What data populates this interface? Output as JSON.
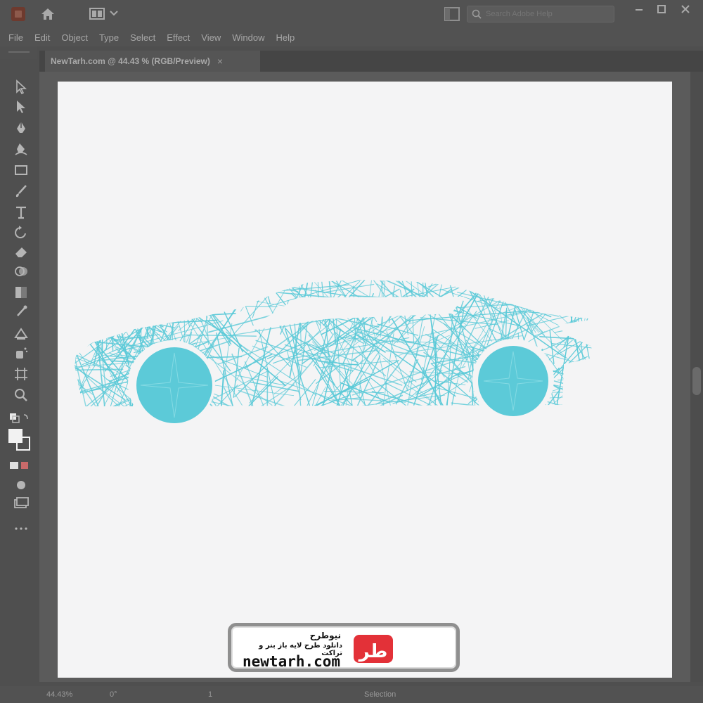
{
  "app": {
    "workspace_icon": "workspace-switcher-icon",
    "search_placeholder": "Search Adobe Help"
  },
  "menu": [
    "File",
    "Edit",
    "Object",
    "Type",
    "Select",
    "Effect",
    "View",
    "Window",
    "Help"
  ],
  "tab": {
    "title": "NewTarh.com @ 44.43 % (RGB/Preview)",
    "close": "×"
  },
  "tools": [
    "selection-tool-icon",
    "direct-selection-tool-icon",
    "pen-tool-icon",
    "curvature-tool-icon",
    "rectangle-tool-icon",
    "paintbrush-tool-icon",
    "type-tool-icon",
    "rotate-tool-icon",
    "eraser-tool-icon",
    "shape-builder-tool-icon",
    "gradient-tool-icon",
    "eyedropper-tool-icon",
    "blend-tool-icon",
    "symbol-sprayer-tool-icon",
    "artboard-tool-icon",
    "zoom-tool-icon",
    "default-colors-icon",
    "fill-stroke-swatch",
    "draw-mode-icon",
    "screen-mode-icon",
    "edit-toolbar-icon"
  ],
  "status": {
    "zoom": "44.43%",
    "rotation": "0°",
    "artboard": "1",
    "tool": "Selection"
  },
  "colors": {
    "car": "#5ccad8",
    "artboard": "#f4f4f5",
    "logo_red": "#e01b22",
    "logo_blue": "#1b3e9a"
  },
  "watermark": {
    "name": "نیوطرح",
    "tagline": "دانلود طرح لایه باز بنر و تراکت",
    "site": "newtarh.com",
    "logo_text": "نیوطرح"
  }
}
